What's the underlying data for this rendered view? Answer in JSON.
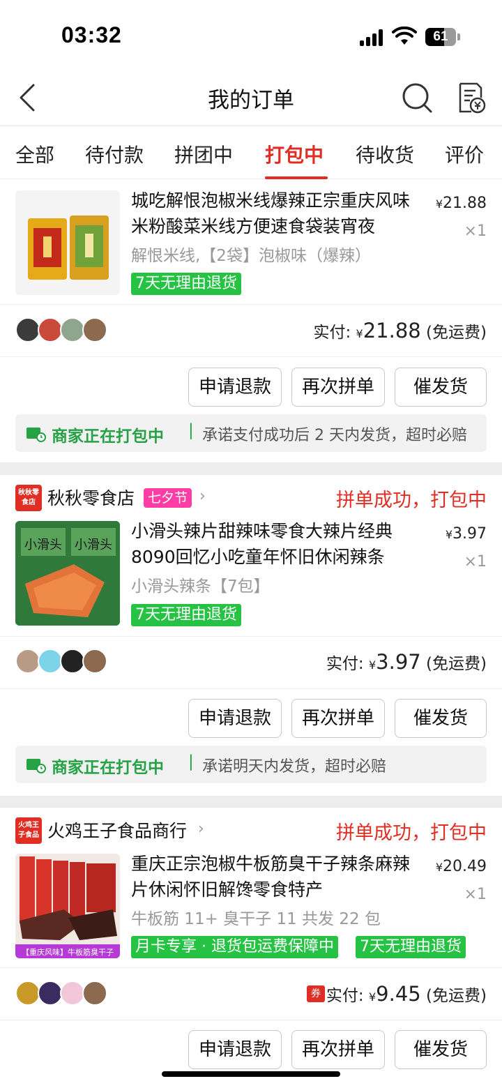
{
  "status_bar": {
    "time": "03:32",
    "battery_level": "61",
    "battery_fraction": 0.61
  },
  "nav": {
    "title": "我的订单"
  },
  "tabs": [
    {
      "label": "全部",
      "active": false
    },
    {
      "label": "待付款",
      "active": false
    },
    {
      "label": "拼团中",
      "active": false
    },
    {
      "label": "打包中",
      "active": true
    },
    {
      "label": "待收货",
      "active": false
    },
    {
      "label": "评价",
      "active": false
    }
  ],
  "orders": [
    {
      "product": {
        "title": "城吃解恨泡椒米线爆辣正宗重庆风味米粉酸菜米线方便速食袋装宵夜",
        "price": "21.88",
        "qty": "×1",
        "spec": "解恨米线,【2袋】泡椒味（爆辣）",
        "badges": [
          "7天无理由退货"
        ]
      },
      "paid_label": "实付:",
      "currency": "¥",
      "paid_amount": "21.88",
      "shipping": "(免运费)",
      "buttons": [
        "申请退款",
        "再次拼单",
        "催发货"
      ],
      "notice_strong": "商家正在打包中",
      "notice_text": "承诺支付成功后 2 天内发货，超时必赔"
    },
    {
      "shop_logo": "秋秋零食店",
      "shop_name": "秋秋零食店",
      "shop_tag": "七夕节",
      "status": "拼单成功，打包中",
      "product": {
        "title": "小滑头辣片甜辣味零食大辣片经典8090回忆小吃童年怀旧休闲辣条",
        "price": "3.97",
        "qty": "×1",
        "spec": "小滑头辣条【7包】",
        "badges": [
          "7天无理由退货"
        ],
        "image_text": "小滑头"
      },
      "paid_label": "实付:",
      "currency": "¥",
      "paid_amount": "3.97",
      "shipping": "(免运费)",
      "buttons": [
        "申请退款",
        "再次拼单",
        "催发货"
      ],
      "notice_strong": "商家正在打包中",
      "notice_text": "承诺明天内发货，超时必赔"
    },
    {
      "shop_logo": "火鸡王子食品",
      "shop_name": "火鸡王子食品商行",
      "status": "拼单成功，打包中",
      "product": {
        "title": "重庆正宗泡椒牛板筋臭干子辣条麻辣片休闲怀旧解馋零食特产",
        "price": "20.49",
        "qty": "×1",
        "spec": "牛板筋 11+ 臭干子 11 共发 22 包",
        "badges": [
          "月卡专享 · 退货包运费保障中",
          "7天无理由退货"
        ],
        "image_text": "【重庆风味】牛板筋臭干子"
      },
      "coupon": "券",
      "paid_label": "实付:",
      "currency": "¥",
      "paid_amount": "9.45",
      "shipping": "(免运费)",
      "buttons": [
        "申请退款",
        "再次拼单",
        "催发货"
      ]
    }
  ],
  "colors": {
    "accent": "#e02e24",
    "green": "#25c244",
    "tag_pink": "#ff3ea5"
  }
}
